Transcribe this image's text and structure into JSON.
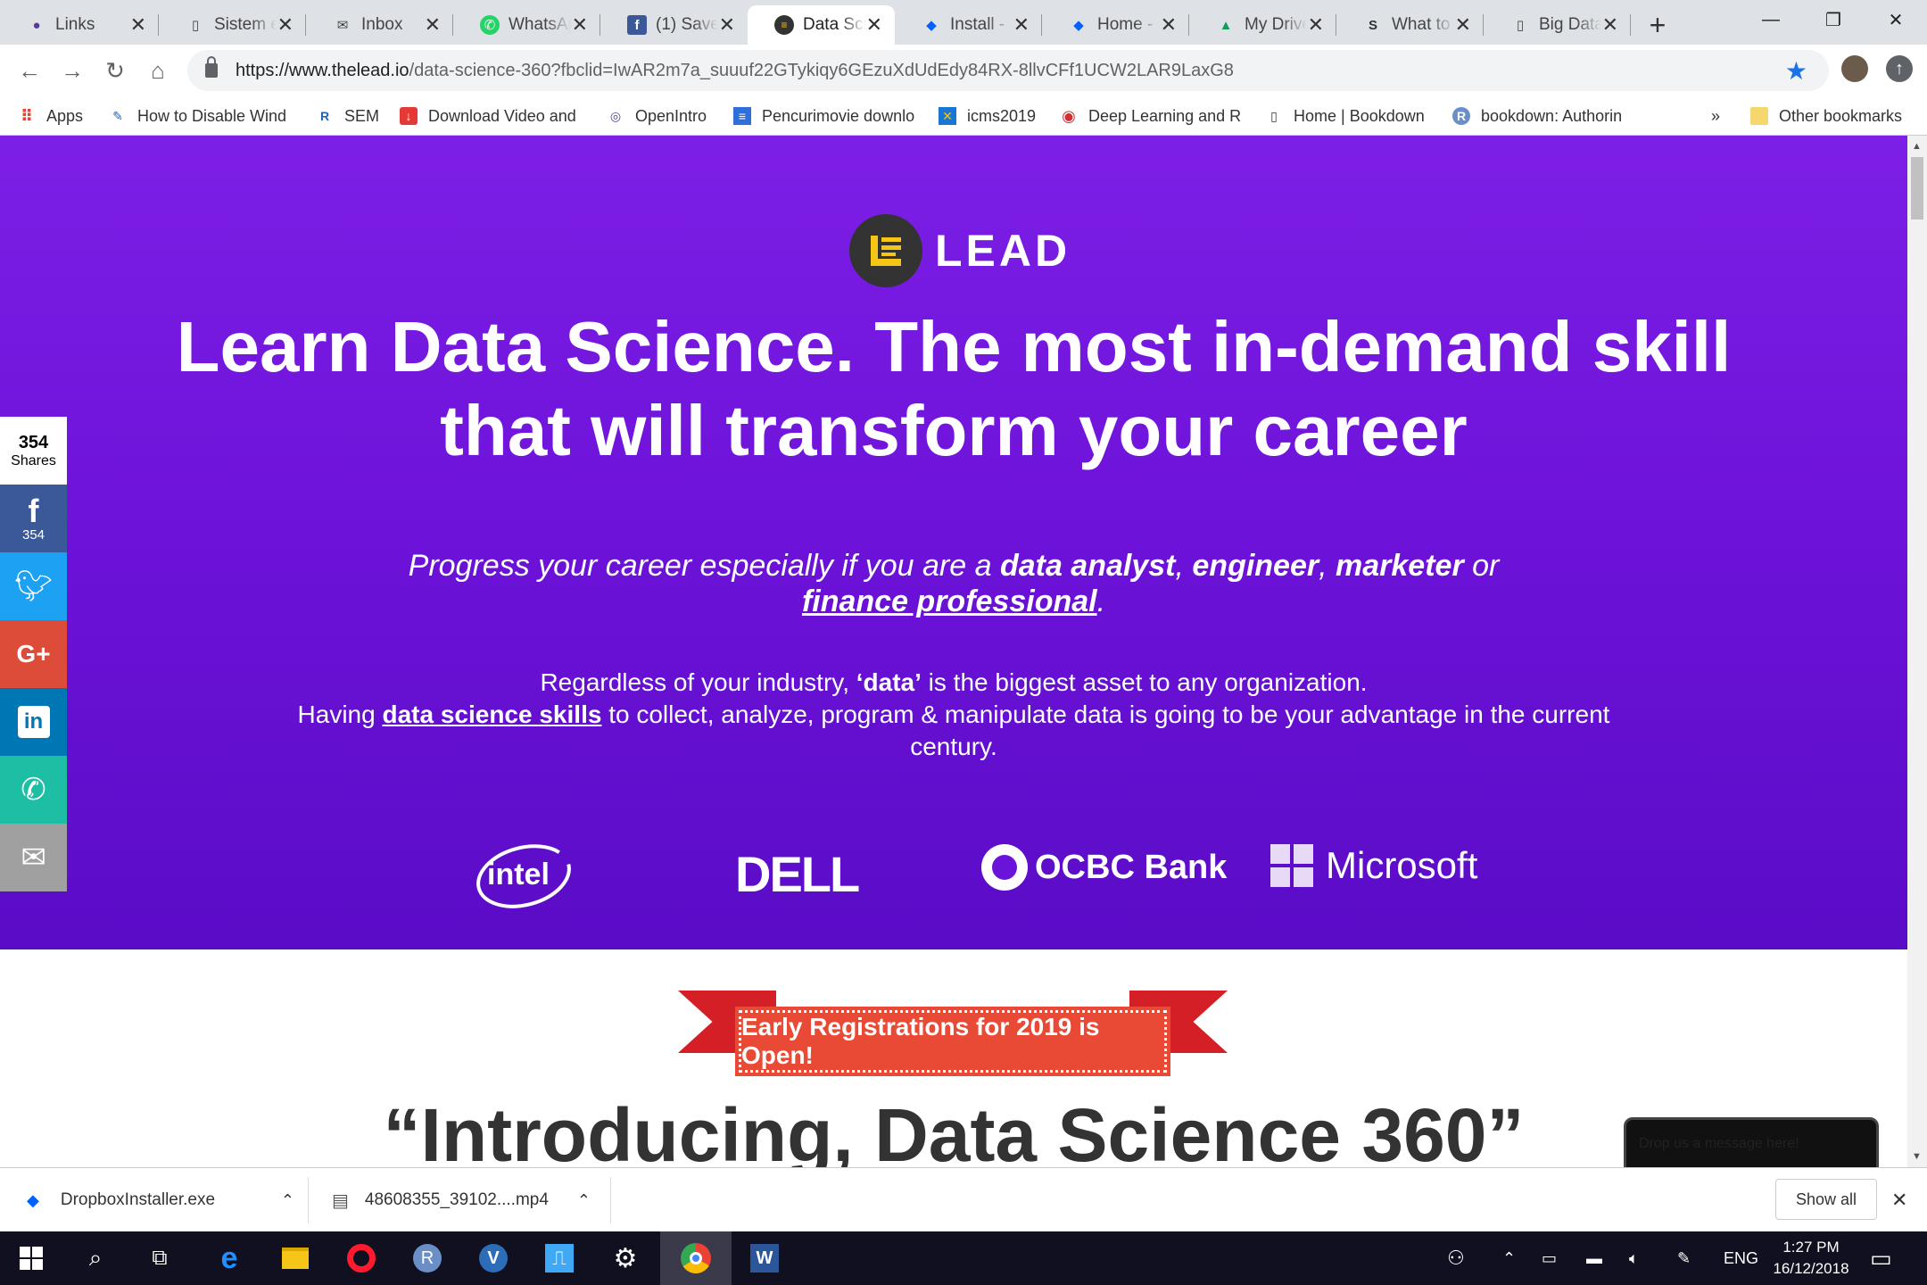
{
  "browser": {
    "tabs": [
      {
        "label": "Links",
        "icon": "github-icon"
      },
      {
        "label": "Sistem e",
        "icon": "document-icon"
      },
      {
        "label": "Inbox",
        "icon": "mail-icon"
      },
      {
        "label": "WhatsAp",
        "icon": "whatsapp-icon"
      },
      {
        "label": "(1) Saved",
        "icon": "facebook-icon"
      },
      {
        "label": "Data Sci",
        "icon": "lead-icon"
      },
      {
        "label": "Install -",
        "icon": "dropbox-icon"
      },
      {
        "label": "Home -",
        "icon": "dropbox-icon"
      },
      {
        "label": "My Drive",
        "icon": "drive-icon"
      },
      {
        "label": "What to",
        "icon": "s-icon"
      },
      {
        "label": "Big Data",
        "icon": "document-icon"
      }
    ],
    "new_tab": "+",
    "url_main": "https://www.thelead.io",
    "url_rest": "/data-science-360?fbclid=IwAR2m7a_suuuf22GTykiqy6GEzuXdUdEdy84RX-8llvCFf1UCW2LAR9LaxG8",
    "bookmarks": [
      {
        "label": "Apps"
      },
      {
        "label": "How to Disable Wind"
      },
      {
        "label": "SEM"
      },
      {
        "label": "Download Video and"
      },
      {
        "label": "OpenIntro"
      },
      {
        "label": "Pencurimovie downlo"
      },
      {
        "label": "icms2019"
      },
      {
        "label": "Deep Learning and R"
      },
      {
        "label": "Home | Bookdown"
      },
      {
        "label": "bookdown: Authorin"
      }
    ],
    "more_bookmarks": "»",
    "other_bookmarks": "Other bookmarks"
  },
  "page": {
    "logo_text": "LEAD",
    "headline": "Learn Data Science. The most in-demand skill that will transform your career",
    "sub1": {
      "prefix": "Progress your career especially if you are a ",
      "b1": "data analyst",
      "c1": ", ",
      "b2": "engineer",
      "c2": ", ",
      "b3": "marketer",
      "or": " or ",
      "b4": "finance professional",
      "end": "."
    },
    "sub2": {
      "line1_pre": "Regardless of your industry, ",
      "line1_bold": "‘data’",
      "line1_post": " is the biggest asset to any organization.",
      "line2_pre": "Having ",
      "line2_link": "data science skills",
      "line2_post": " to collect, analyze, program & manipulate data is going to be your advantage in the current century."
    },
    "brands": [
      "intel",
      "DELL",
      "OCBC Bank",
      "Microsoft"
    ],
    "banner": "Early Registrations for 2019 is Open!",
    "intro": "“Introducing, Data Science 360”",
    "chat": "Drop us a message here!"
  },
  "share": {
    "count": "354",
    "label": "Shares",
    "facebook_count": "354"
  },
  "downloads": {
    "items": [
      "DropboxInstaller.exe",
      "48608355_39102....mp4"
    ],
    "show_all": "Show all"
  },
  "taskbar": {
    "lang": "ENG",
    "time": "1:27 PM",
    "date": "16/12/2018"
  }
}
